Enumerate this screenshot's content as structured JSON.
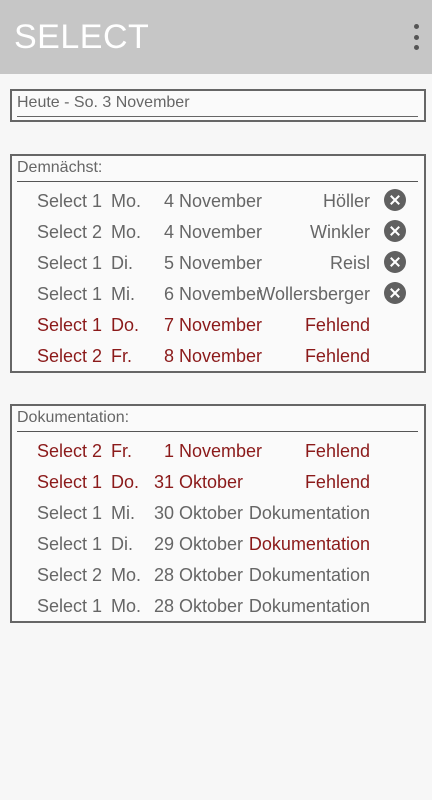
{
  "app": {
    "title": "SELECT",
    "menu_icon": "more-vert-icon"
  },
  "today": {
    "text": "Heute - So. 3 November"
  },
  "upcoming": {
    "header": "Demnächst:",
    "rows": [
      {
        "select": "Select 1",
        "day": "Mo.",
        "date": "4",
        "month": "November",
        "name": "Höller",
        "missing": false,
        "delete": true
      },
      {
        "select": "Select 2",
        "day": "Mo.",
        "date": "4",
        "month": "November",
        "name": "Winkler",
        "missing": false,
        "delete": true
      },
      {
        "select": "Select 1",
        "day": "Di.",
        "date": "5",
        "month": "November",
        "name": "Reisl",
        "missing": false,
        "delete": true
      },
      {
        "select": "Select 1",
        "day": "Mi.",
        "date": "6",
        "month": "November",
        "name": "Wollersberger",
        "missing": false,
        "delete": true
      },
      {
        "select": "Select 1",
        "day": "Do.",
        "date": "7",
        "month": "November",
        "name": "Fehlend",
        "missing": true,
        "delete": false
      },
      {
        "select": "Select 2",
        "day": "Fr.",
        "date": "8",
        "month": "November",
        "name": "Fehlend",
        "missing": true,
        "delete": false
      }
    ]
  },
  "documentation": {
    "header": "Dokumentation:",
    "rows": [
      {
        "select": "Select 2",
        "day": "Fr.",
        "date": "1",
        "month": "November",
        "name": "Fehlend",
        "missing": true,
        "name_red": false
      },
      {
        "select": "Select 1",
        "day": "Do.",
        "date": "31",
        "month": "Oktober",
        "name": "Fehlend",
        "missing": true,
        "name_red": false
      },
      {
        "select": "Select 1",
        "day": "Mi.",
        "date": "30",
        "month": "Oktober",
        "name": "Dokumentation",
        "missing": false,
        "name_red": false
      },
      {
        "select": "Select 1",
        "day": "Di.",
        "date": "29",
        "month": "Oktober",
        "name": "Dokumentation",
        "missing": false,
        "name_red": true
      },
      {
        "select": "Select 2",
        "day": "Mo.",
        "date": "28",
        "month": "Oktober",
        "name": "Dokumentation",
        "missing": false,
        "name_red": false
      },
      {
        "select": "Select 1",
        "day": "Mo.",
        "date": "28",
        "month": "Oktober",
        "name": "Dokumentation",
        "missing": false,
        "name_red": false
      }
    ]
  },
  "colors": {
    "appbar": "#c6c6c6",
    "missing": "#8b1a1a",
    "text": "#666666"
  }
}
